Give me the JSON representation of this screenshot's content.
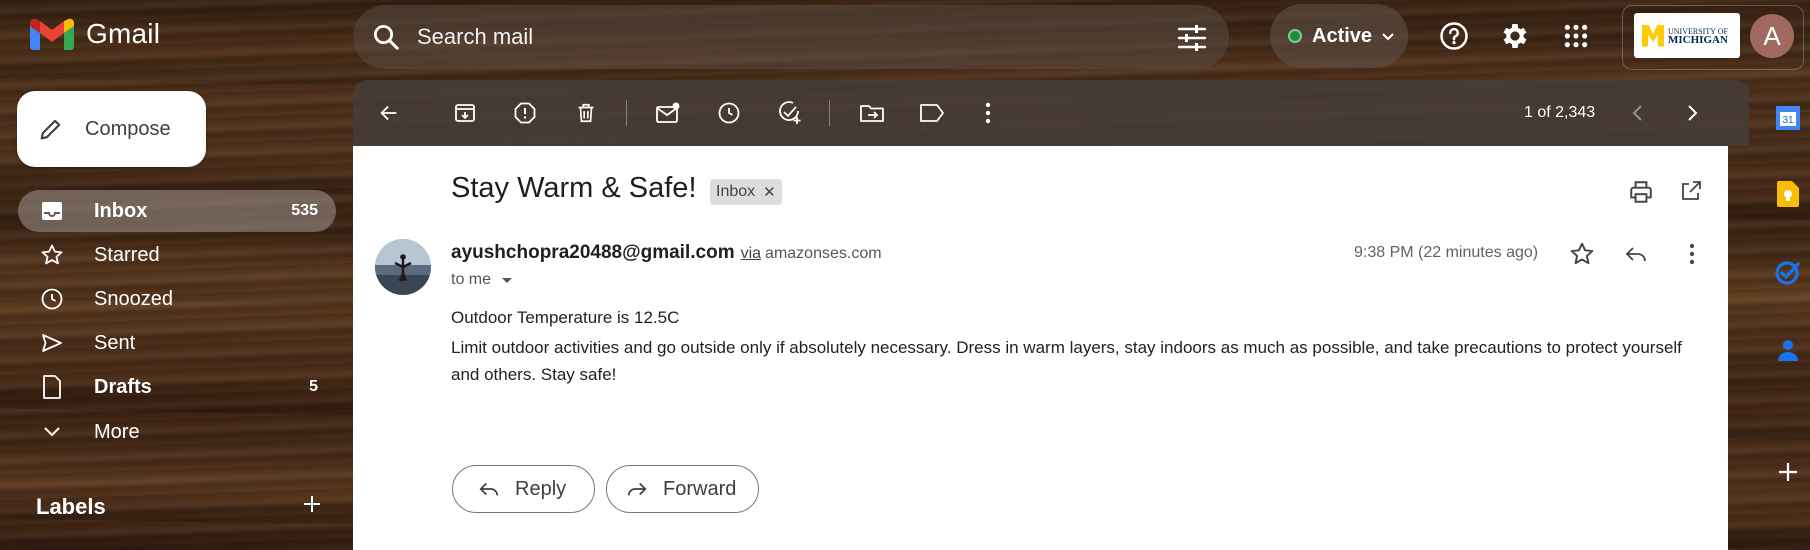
{
  "app": {
    "name": "Gmail"
  },
  "search": {
    "placeholder": "Search mail"
  },
  "status": {
    "label": "Active",
    "color": "#1e8e3e"
  },
  "account": {
    "initial": "A",
    "org_line1": "UNIVERSITY OF",
    "org_line2": "MICHIGAN"
  },
  "compose": {
    "label": "Compose"
  },
  "nav": {
    "items": [
      {
        "label": "Inbox",
        "count": "535",
        "icon": "inbox-icon",
        "selected": true
      },
      {
        "label": "Starred",
        "count": "",
        "icon": "star-icon"
      },
      {
        "label": "Snoozed",
        "count": "",
        "icon": "clock-icon"
      },
      {
        "label": "Sent",
        "count": "",
        "icon": "send-icon"
      },
      {
        "label": "Drafts",
        "count": "5",
        "icon": "draft-icon"
      },
      {
        "label": "More",
        "count": "",
        "icon": "chevron-down-icon"
      }
    ],
    "labels_title": "Labels"
  },
  "toolbar": {
    "counter": "1 of 2,343"
  },
  "email": {
    "subject": "Stay Warm & Safe!",
    "chip": "Inbox",
    "sender": "ayushchopra20488@gmail.com",
    "via": "via",
    "via_domain": "amazonses.com",
    "to": "to me",
    "time": "9:38 PM (22 minutes ago)",
    "line1": "Outdoor Temperature is 12.5C",
    "body": "Limit outdoor activities and go outside only if absolutely necessary. Dress in warm layers, stay indoors as much as possible, and take precautions to protect yourself and others. Stay safe!",
    "reply_label": "Reply",
    "forward_label": "Forward"
  },
  "side_panel": {
    "calendar_day": "31"
  }
}
